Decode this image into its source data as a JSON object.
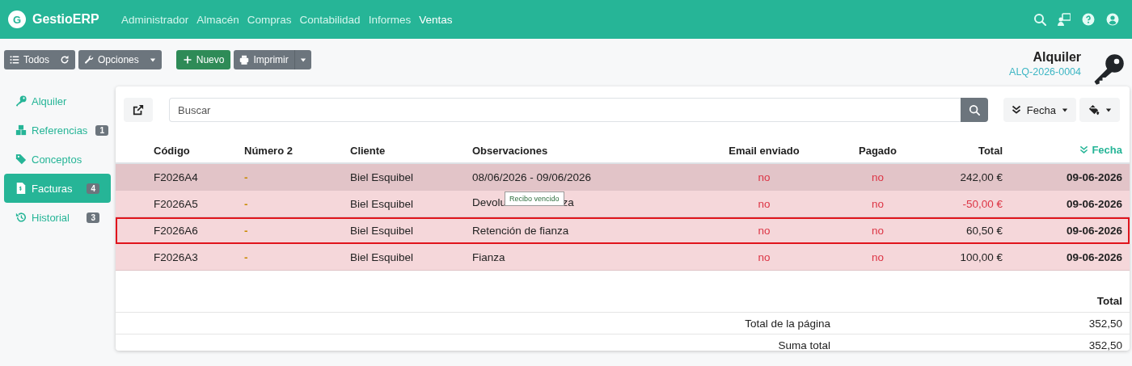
{
  "navbar": {
    "brand": "GestioERP",
    "logo_letter": "G",
    "menu": [
      {
        "label": "Administrador",
        "selected": false
      },
      {
        "label": "Almacén",
        "selected": false
      },
      {
        "label": "Compras",
        "selected": false
      },
      {
        "label": "Contabilidad",
        "selected": false
      },
      {
        "label": "Informes",
        "selected": false
      },
      {
        "label": "Ventas",
        "selected": true
      }
    ]
  },
  "toolbar": {
    "todos": "Todos",
    "opciones": "Opciones",
    "nuevo": "Nuevo",
    "imprimir": "Imprimir"
  },
  "header": {
    "title": "Alquiler",
    "code": "ALQ-2026-0004"
  },
  "sidebar": {
    "items": [
      {
        "label": "Alquiler",
        "selected": false
      },
      {
        "label": "Referencias",
        "badge": "1",
        "selected": false
      },
      {
        "label": "Conceptos",
        "selected": false
      },
      {
        "label": "Facturas",
        "badge": "4",
        "selected": true
      },
      {
        "label": "Historial",
        "badge": "3",
        "selected": false
      }
    ]
  },
  "list": {
    "search_placeholder": "Buscar",
    "order_button": "Fecha",
    "columns": [
      {
        "label": "Código",
        "sorted": false
      },
      {
        "label": "Número 2",
        "sorted": false
      },
      {
        "label": "Cliente",
        "sorted": false
      },
      {
        "label": "Observaciones",
        "sorted": false
      },
      {
        "label": "Email enviado",
        "sorted": false
      },
      {
        "label": "Pagado",
        "sorted": false
      },
      {
        "label": "Total",
        "sorted": false
      },
      {
        "label": "Fecha",
        "sorted": true
      }
    ],
    "rows": [
      {
        "codigo": "F2026A4",
        "numero2": "-",
        "cliente": "Biel Esquibel",
        "observaciones": [
          "08/06/2026 - 09/06/2026"
        ],
        "email": "no",
        "pagado": "no",
        "total": "242,00 €",
        "negative": false,
        "fecha": "09-06-2026",
        "hovered": true,
        "highlighted": false
      },
      {
        "codigo": "F2026A5",
        "numero2": "-",
        "cliente": "Biel Esquibel",
        "observaciones": [
          "Devolu",
          "za"
        ],
        "tooltip": "Recibo vencido",
        "email": "no",
        "pagado": "no",
        "total": "-50,00 €",
        "negative": true,
        "fecha": "09-06-2026",
        "hovered": false,
        "highlighted": false
      },
      {
        "codigo": "F2026A6",
        "numero2": "-",
        "cliente": "Biel Esquibel",
        "observaciones": [
          "Retención de fianza"
        ],
        "email": "no",
        "pagado": "no",
        "total": "60,50 €",
        "negative": false,
        "fecha": "09-06-2026",
        "hovered": false,
        "highlighted": true
      },
      {
        "codigo": "F2026A3",
        "numero2": "-",
        "cliente": "Biel Esquibel",
        "observaciones": [
          "Fianza"
        ],
        "email": "no",
        "pagado": "no",
        "total": "100,00 €",
        "negative": false,
        "fecha": "09-06-2026",
        "hovered": false,
        "highlighted": false
      }
    ],
    "totals": {
      "heading": "Total",
      "rows": [
        {
          "label": "Total de la página",
          "value": "352,50"
        },
        {
          "label": "Suma total",
          "value": "352,50"
        }
      ]
    }
  }
}
